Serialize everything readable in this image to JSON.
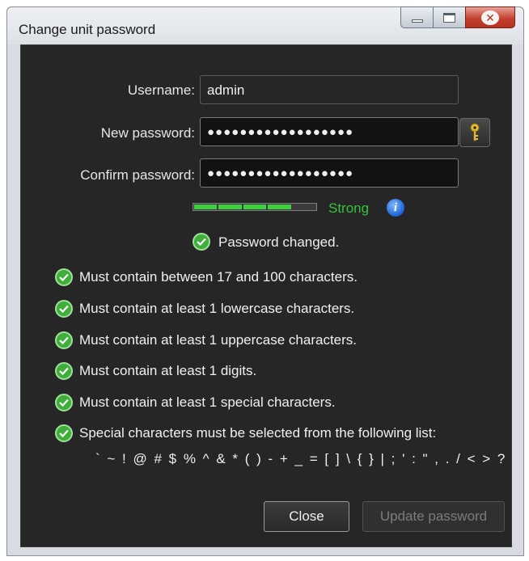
{
  "window": {
    "title": "Change unit password"
  },
  "form": {
    "username_label": "Username:",
    "username_value": "admin",
    "new_password_label": "New password:",
    "new_password_value": "●●●●●●●●●●●●●●●●●●",
    "confirm_password_label": "Confirm password:",
    "confirm_password_value": "●●●●●●●●●●●●●●●●●●"
  },
  "strength": {
    "label": "Strength",
    "text": "Strong",
    "filled_segments": 4,
    "total_segments": 5,
    "fill_color": "#3dd13d",
    "text_color": "#36c23a"
  },
  "status": {
    "message": "Password changed."
  },
  "rules": [
    {
      "text": "Must contain between 17 and 100 characters."
    },
    {
      "text": "Must contain at least 1 lowercase characters."
    },
    {
      "text": "Must contain at least 1 uppercase characters."
    },
    {
      "text": "Must contain at least 1 digits."
    },
    {
      "text": "Must contain at least 1 special characters."
    },
    {
      "text": "Special characters must be selected from the following list:"
    }
  ],
  "special_characters": "` ~ ! @ # $ % ^ & * ( ) - + _ = [ ] \\ { } | ; ' : \" , . / < > ?",
  "buttons": {
    "close_label": "Close",
    "update_label": "Update password"
  },
  "icons": {
    "key": "key-icon",
    "info": "info-icon",
    "check": "check-circle-icon"
  }
}
